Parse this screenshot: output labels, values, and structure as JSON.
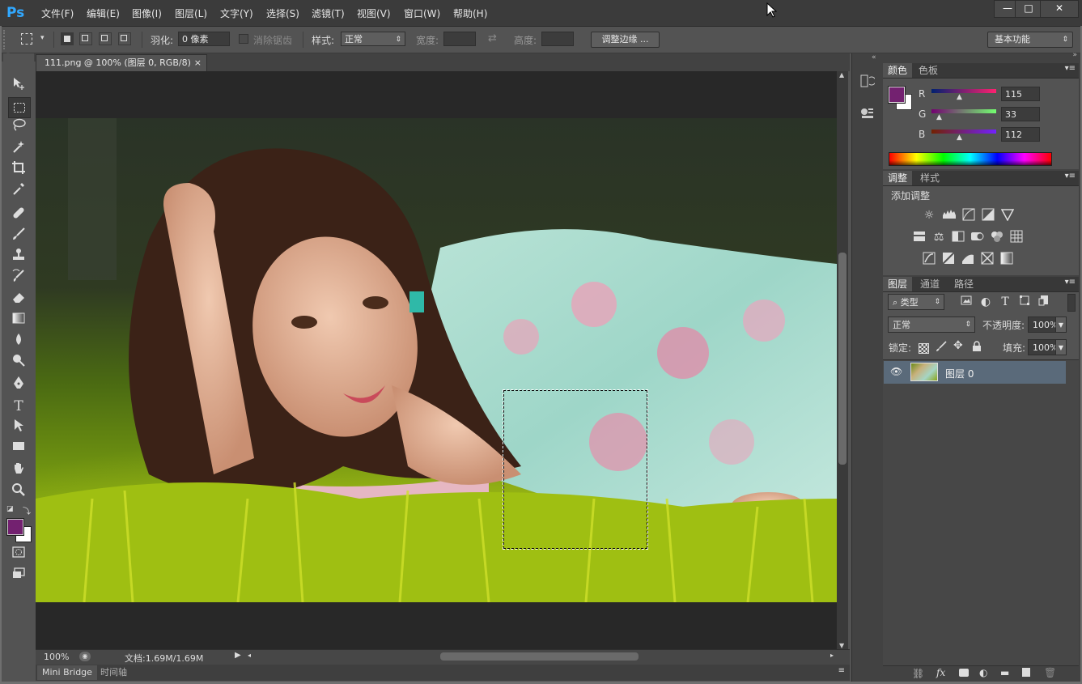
{
  "app": {
    "logo": "Ps"
  },
  "menu": [
    "文件(F)",
    "编辑(E)",
    "图像(I)",
    "图层(L)",
    "文字(Y)",
    "选择(S)",
    "滤镜(T)",
    "视图(V)",
    "窗口(W)",
    "帮助(H)"
  ],
  "window_controls": {
    "minimize": "—",
    "maximize": "□",
    "close": "✕"
  },
  "options_bar": {
    "feather_label": "羽化:",
    "feather_value": "0 像素",
    "antialias_label": "消除锯齿",
    "style_label": "样式:",
    "style_value": "正常",
    "width_label": "宽度:",
    "height_label": "高度:",
    "refine_edge_button": "调整边缘 ...",
    "workspace": "基本功能"
  },
  "document": {
    "tab_title": "111.png @ 100% (图层 0, RGB/8)",
    "tab_close": "×"
  },
  "status": {
    "zoom": "100%",
    "doc_info": "文档:1.69M/1.69M"
  },
  "bottom_tabs": [
    "Mini Bridge",
    "时间轴"
  ],
  "color_panel": {
    "tabs": [
      "颜色",
      "色板"
    ],
    "foreground": "#732170",
    "background": "#ffffff",
    "channels": [
      {
        "label": "R",
        "value": "115"
      },
      {
        "label": "G",
        "value": "33"
      },
      {
        "label": "B",
        "value": "112"
      }
    ]
  },
  "adjustments_panel": {
    "tabs": [
      "调整",
      "样式"
    ],
    "heading": "添加调整"
  },
  "layers_panel": {
    "tabs": [
      "图层",
      "通道",
      "路径"
    ],
    "filter_kind": "类型",
    "blend_mode": "正常",
    "opacity_label": "不透明度:",
    "opacity_value": "100%",
    "lock_label": "锁定:",
    "fill_label": "填充:",
    "fill_value": "100%",
    "layers": [
      {
        "name": "图层 0",
        "visible": true
      }
    ]
  },
  "colors": {
    "accent": "#31a8ff",
    "selected_layer": "#5a6a7a",
    "annotation_arrow": "#e02020"
  }
}
